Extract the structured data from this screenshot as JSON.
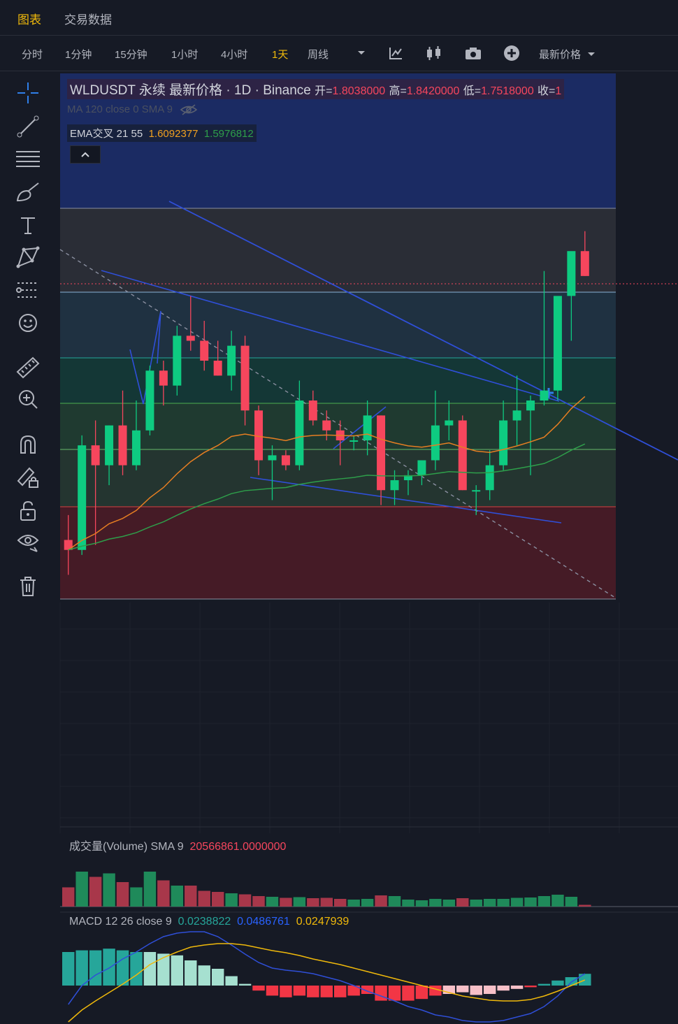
{
  "top_tabs": [
    {
      "label": "图表",
      "active": true
    },
    {
      "label": "交易数据",
      "active": false
    }
  ],
  "toolbar": {
    "intervals": [
      {
        "label": "分时",
        "active": false
      },
      {
        "label": "1分钟",
        "active": false
      },
      {
        "label": "15分钟",
        "active": false
      },
      {
        "label": "1小时",
        "active": false
      },
      {
        "label": "4小时",
        "active": false
      },
      {
        "label": "1天",
        "active": true
      },
      {
        "label": "周线",
        "active": false
      }
    ],
    "price_type": "最新价格",
    "icons": [
      "chevron-down-icon",
      "indicators-icon",
      "candle-style-icon",
      "camera-icon",
      "add-icon"
    ]
  },
  "left_tools": [
    "crosshair-icon",
    "trendline-icon",
    "fib-lines-icon",
    "brush-icon",
    "text-icon",
    "pattern-icon",
    "measure-lines-icon",
    "emoji-icon",
    "ruler-icon",
    "zoom-icon",
    "magnet-icon",
    "lock-drawing-icon",
    "unlock-icon",
    "eye-icon",
    "trash-icon"
  ],
  "legend": {
    "title": "WLDUSDT 永续 最新价格 · 1D · Binance",
    "open_label": "开=",
    "open": "1.8038000",
    "high_label": "高=",
    "high": "1.8420000",
    "low_label": "低=",
    "low": "1.7518000",
    "close_label": "收=",
    "close": "1",
    "ma_text": "MA 120 close 0 SMA 9",
    "ema_label": "EMA交叉 21 55",
    "ema_fast": "1.6092377",
    "ema_slow": "1.5976812"
  },
  "volume_legend": {
    "label": "成交量(Volume) SMA 9",
    "value": "20566861.0000000"
  },
  "macd_legend": {
    "label": "MACD 12 26 close 9",
    "hist": "0.0238822",
    "macd": "0.0486761",
    "signal": "0.0247939"
  },
  "colors": {
    "up": "#0ecb81",
    "down": "#f6465d",
    "accent": "#f0b90b",
    "trend": "#2f4fd8",
    "ema_fast": "#e67e22",
    "ema_slow": "#2e9e4a"
  },
  "chart_data": {
    "type": "candlestick",
    "symbol": "WLDUSDT",
    "interval": "1D",
    "candles": [
      {
        "o": 1.22,
        "h": 1.27,
        "l": 1.15,
        "c": 1.2
      },
      {
        "o": 1.2,
        "h": 1.43,
        "l": 1.19,
        "c": 1.41
      },
      {
        "o": 1.41,
        "h": 1.46,
        "l": 1.21,
        "c": 1.37
      },
      {
        "o": 1.37,
        "h": 1.45,
        "l": 1.33,
        "c": 1.45
      },
      {
        "o": 1.45,
        "h": 1.52,
        "l": 1.35,
        "c": 1.37
      },
      {
        "o": 1.37,
        "h": 1.5,
        "l": 1.36,
        "c": 1.44
      },
      {
        "o": 1.44,
        "h": 1.57,
        "l": 1.43,
        "c": 1.56
      },
      {
        "o": 1.56,
        "h": 1.58,
        "l": 1.49,
        "c": 1.53
      },
      {
        "o": 1.53,
        "h": 1.65,
        "l": 1.51,
        "c": 1.63
      },
      {
        "o": 1.63,
        "h": 1.71,
        "l": 1.6,
        "c": 1.62
      },
      {
        "o": 1.62,
        "h": 1.66,
        "l": 1.56,
        "c": 1.58
      },
      {
        "o": 1.58,
        "h": 1.62,
        "l": 1.55,
        "c": 1.55
      },
      {
        "o": 1.55,
        "h": 1.64,
        "l": 1.52,
        "c": 1.61
      },
      {
        "o": 1.61,
        "h": 1.63,
        "l": 1.45,
        "c": 1.48
      },
      {
        "o": 1.48,
        "h": 1.49,
        "l": 1.35,
        "c": 1.38
      },
      {
        "o": 1.38,
        "h": 1.41,
        "l": 1.3,
        "c": 1.39
      },
      {
        "o": 1.39,
        "h": 1.4,
        "l": 1.36,
        "c": 1.37
      },
      {
        "o": 1.37,
        "h": 1.54,
        "l": 1.36,
        "c": 1.5
      },
      {
        "o": 1.5,
        "h": 1.52,
        "l": 1.45,
        "c": 1.46
      },
      {
        "o": 1.46,
        "h": 1.48,
        "l": 1.42,
        "c": 1.44
      },
      {
        "o": 1.44,
        "h": 1.46,
        "l": 1.37,
        "c": 1.42
      },
      {
        "o": 1.42,
        "h": 1.43,
        "l": 1.4,
        "c": 1.42
      },
      {
        "o": 1.42,
        "h": 1.5,
        "l": 1.39,
        "c": 1.47
      },
      {
        "o": 1.47,
        "h": 1.47,
        "l": 1.29,
        "c": 1.32
      },
      {
        "o": 1.32,
        "h": 1.36,
        "l": 1.29,
        "c": 1.34
      },
      {
        "o": 1.34,
        "h": 1.36,
        "l": 1.31,
        "c": 1.35
      },
      {
        "o": 1.35,
        "h": 1.38,
        "l": 1.33,
        "c": 1.38
      },
      {
        "o": 1.38,
        "h": 1.52,
        "l": 1.36,
        "c": 1.45
      },
      {
        "o": 1.45,
        "h": 1.5,
        "l": 1.42,
        "c": 1.46
      },
      {
        "o": 1.46,
        "h": 1.47,
        "l": 1.32,
        "c": 1.32
      },
      {
        "o": 1.32,
        "h": 1.33,
        "l": 1.27,
        "c": 1.32
      },
      {
        "o": 1.32,
        "h": 1.4,
        "l": 1.3,
        "c": 1.37
      },
      {
        "o": 1.37,
        "h": 1.5,
        "l": 1.36,
        "c": 1.46
      },
      {
        "o": 1.46,
        "h": 1.55,
        "l": 1.41,
        "c": 1.48
      },
      {
        "o": 1.48,
        "h": 1.51,
        "l": 1.35,
        "c": 1.5
      },
      {
        "o": 1.5,
        "h": 1.76,
        "l": 1.49,
        "c": 1.52
      },
      {
        "o": 1.52,
        "h": 1.68,
        "l": 1.5,
        "c": 1.71
      },
      {
        "o": 1.71,
        "h": 1.77,
        "l": 1.62,
        "c": 1.8
      },
      {
        "o": 1.8,
        "h": 1.84,
        "l": 1.75,
        "c": 1.75
      }
    ],
    "ema_fast_value": 1.6092377,
    "ema_slow_value": 1.5976812,
    "volume_sma": 20566861.0,
    "macd": {
      "hist": 0.0238822,
      "macd": 0.0486761,
      "signal": 0.0247939
    }
  }
}
